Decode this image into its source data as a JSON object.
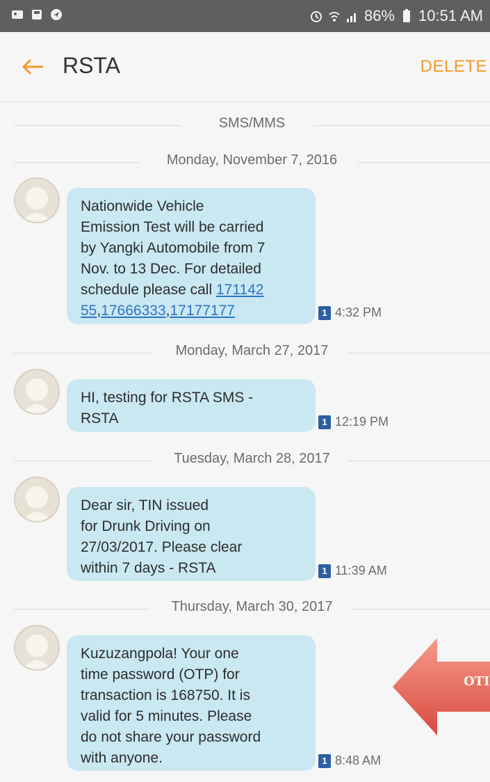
{
  "status_bar": {
    "battery": "86%",
    "time": "10:51 AM",
    "icons_left": [
      "image-icon",
      "save-icon",
      "navigation-icon"
    ],
    "icons_right": [
      "alarm-icon",
      "wifi-icon",
      "signal-icon",
      "battery-icon"
    ]
  },
  "app_bar": {
    "title": "RSTA",
    "delete_label": "DELETE"
  },
  "conversation": {
    "channel_label": "SMS/MMS",
    "dates": [
      "Monday, November 7, 2016",
      "Monday, March 27, 2017",
      "Tuesday, March 28, 2017",
      "Thursday, March 30, 2017"
    ],
    "messages": [
      {
        "lines": [
          "Nationwide Vehicle",
          "Emission Test will be carried",
          "by Yangki Automobile from 7",
          "Nov. to 13 Dec. For detailed",
          "schedule please call "
        ],
        "link_1": "171142",
        "link_2": "55",
        "link_3": "17666333",
        "link_4": "17177177",
        "sim": "1",
        "time": "4:32 PM"
      },
      {
        "lines": [
          "HI, testing for RSTA SMS -",
          "RSTA"
        ],
        "sim": "1",
        "time": "12:19 PM"
      },
      {
        "lines": [
          "Dear sir, TIN issued",
          "for Drunk Driving on",
          "27/03/2017. Please clear",
          "within 7 days - RSTA"
        ],
        "sim": "1",
        "time": "11:39 AM"
      },
      {
        "lines": [
          "Kuzuzangpola! Your one",
          "time password (OTP) for",
          "transaction is 168750. It is",
          "valid for 5 minutes. Please",
          "do not share your password",
          "with anyone."
        ],
        "sim": "1",
        "time": "8:48 AM"
      }
    ]
  },
  "annotation": {
    "label": "OTI",
    "color": "#e9534f"
  }
}
